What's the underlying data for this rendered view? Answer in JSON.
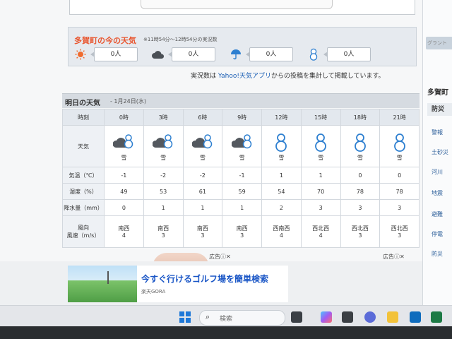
{
  "current": {
    "title": "多賀町の今の天気",
    "note": "※11時54分〜12時54分の実況数",
    "counts": [
      {
        "icon": "sun-icon",
        "color": "#f06b2e",
        "value": "0人"
      },
      {
        "icon": "cloud-icon",
        "color": "#4a4f55",
        "value": "0人"
      },
      {
        "icon": "umbrella-icon",
        "color": "#2d7fd0",
        "value": "0人"
      },
      {
        "icon": "snowman-icon",
        "color": "#2d7fd0",
        "value": "0人"
      }
    ],
    "footnote_pre": "実況数は",
    "footnote_link": "Yahoo!天気アプリ",
    "footnote_post": "からの投稿を集計して掲載しています。"
  },
  "tomorrow": {
    "title": "明日の天気",
    "date": "- 1月24日(水)",
    "row_labels": {
      "time": "時刻",
      "weather": "天気",
      "temp": "気温（℃）",
      "humidity": "湿度（%）",
      "precip": "降水量（mm）",
      "wind_dir": "風向",
      "wind_speed": "風速（m/s）"
    },
    "hours": [
      "0時",
      "3時",
      "6時",
      "9時",
      "12時",
      "15時",
      "18時",
      "21時"
    ],
    "weather": [
      {
        "icon": "cloud-snow-icon",
        "label": "雪"
      },
      {
        "icon": "cloud-snow-icon",
        "label": "雪"
      },
      {
        "icon": "cloud-snow-icon",
        "label": "雪"
      },
      {
        "icon": "cloud-snow-icon",
        "label": "雪"
      },
      {
        "icon": "snowman-icon",
        "label": "雪"
      },
      {
        "icon": "snowman-icon",
        "label": "雪"
      },
      {
        "icon": "snowman-icon",
        "label": "雪"
      },
      {
        "icon": "snowman-icon",
        "label": "雪"
      }
    ],
    "temp": [
      "-1",
      "-2",
      "-2",
      "-1",
      "1",
      "1",
      "0",
      "0"
    ],
    "humidity": [
      "49",
      "53",
      "61",
      "59",
      "54",
      "70",
      "78",
      "78"
    ],
    "precip": [
      "0",
      "1",
      "1",
      "1",
      "2",
      "3",
      "3",
      "3"
    ],
    "wind_dir": [
      "南西",
      "南西",
      "南西",
      "南西",
      "西南西",
      "西北西",
      "西北西",
      "西北西"
    ],
    "wind_speed": [
      "4",
      "3",
      "3",
      "3",
      "4",
      "4",
      "3",
      "3"
    ]
  },
  "sidebar": {
    "image_text": "グラント",
    "title": "多賀町",
    "sub": "防災",
    "items": [
      "警報",
      "土砂災",
      "河川",
      "地震",
      "避難",
      "停電",
      "防災"
    ]
  },
  "ad": {
    "label_left": "広告ⓘ✕",
    "label_right": "広告ⓘ✕",
    "title": "今すぐ行けるゴルフ場を簡単検索",
    "source": "楽天GORA"
  },
  "taskbar": {
    "search_placeholder": "検索"
  }
}
